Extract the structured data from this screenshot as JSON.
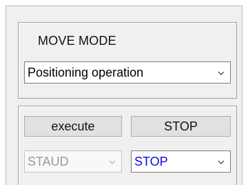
{
  "move_mode": {
    "title": "MOVE MODE",
    "selected": "Positioning operation"
  },
  "actions": {
    "execute_label": "execute",
    "stop_label": "STOP"
  },
  "selectors": {
    "staud_value": "STAUD",
    "stop_value": "STOP"
  },
  "colors": {
    "panel_bg": "#f0f0f0",
    "stop_text": "#0a0ae6",
    "disabled_text": "#9b9b9b"
  }
}
